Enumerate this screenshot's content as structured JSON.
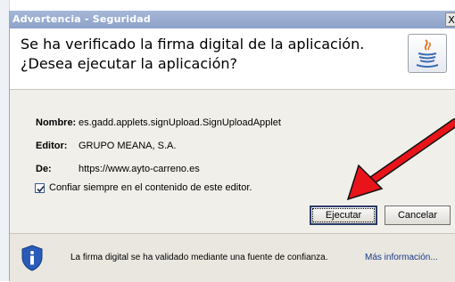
{
  "window": {
    "title": "Advertencia - Seguridad",
    "close_glyph": "X"
  },
  "header": {
    "line1": "Se ha verificado la firma digital de la aplicación.",
    "line2": "¿Desea ejecutar la aplicación?",
    "icon": "java-icon"
  },
  "details": {
    "name_label": "Nombre:",
    "name_value": "es.gadd.applets.signUpload.SignUploadApplet",
    "publisher_label": "Editor:",
    "publisher_value": "GRUPO MEANA, S.A.",
    "from_label": "De:",
    "from_value": "https://www.ayto-carreno.es"
  },
  "trust_checkbox": {
    "checked": true,
    "label": "Confiar siempre en el contenido de este editor."
  },
  "buttons": {
    "run": "Ejecutar",
    "cancel": "Cancelar"
  },
  "footer": {
    "icon": "shield-info-icon",
    "text": "La firma digital se ha validado mediante una fuente de confianza.",
    "more_link": "Más información..."
  },
  "colors": {
    "title_bar": "#8da2c8",
    "dialog_bg": "#f0efe9",
    "arrow": "#e8141a",
    "shield": "#2a5bb8"
  }
}
